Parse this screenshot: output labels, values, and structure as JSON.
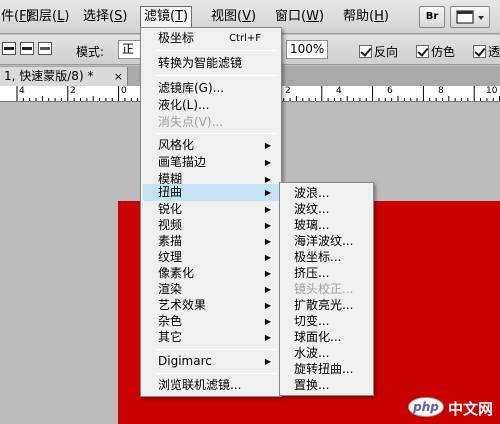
{
  "menubar": {
    "items": [
      {
        "label": "件(",
        "accel": "F",
        "tail": ")"
      },
      {
        "label": "图层(",
        "accel": "L",
        "tail": ")"
      },
      {
        "label": "选择(",
        "accel": "S",
        "tail": ")"
      },
      {
        "label": "滤镜(",
        "accel": "T",
        "tail": ")"
      },
      {
        "label": "视图(",
        "accel": "V",
        "tail": ")"
      },
      {
        "label": "窗口(",
        "accel": "W",
        "tail": ")"
      },
      {
        "label": "帮助(",
        "accel": "H",
        "tail": ")"
      }
    ],
    "bridge_button": "Br"
  },
  "options": {
    "mode_label": "模式:",
    "mode_value": "正常",
    "opacity_value": "100%",
    "reverse_label": "反向",
    "dither_label": "仿色",
    "transparency_label": "透"
  },
  "document": {
    "tab_title": "1, 快速蒙版/8) *",
    "close_glyph": "×"
  },
  "ruler": {
    "labels": [
      "4",
      "2",
      "0",
      "2",
      "4",
      "6",
      "8",
      "10"
    ]
  },
  "filter_menu": {
    "items": [
      {
        "label": "极坐标",
        "shortcut": "Ctrl+F"
      },
      {
        "label": "转换为智能滤镜"
      },
      {
        "label": "滤镜库(G)..."
      },
      {
        "label": "液化(L)..."
      },
      {
        "label": "消失点(V)...",
        "disabled": true
      },
      {
        "label": "风格化"
      },
      {
        "label": "画笔描边"
      },
      {
        "label": "模糊"
      },
      {
        "label": "扭曲"
      },
      {
        "label": "锐化"
      },
      {
        "label": "视频"
      },
      {
        "label": "素描"
      },
      {
        "label": "纹理"
      },
      {
        "label": "像素化"
      },
      {
        "label": "渲染"
      },
      {
        "label": "艺术效果"
      },
      {
        "label": "杂色"
      },
      {
        "label": "其它"
      },
      {
        "label": "Digimarc"
      },
      {
        "label": "浏览联机滤镜..."
      }
    ],
    "arrow_glyph": "▶"
  },
  "distort_submenu": {
    "items": [
      {
        "label": "波浪..."
      },
      {
        "label": "波纹..."
      },
      {
        "label": "玻璃..."
      },
      {
        "label": "海洋波纹..."
      },
      {
        "label": "极坐标..."
      },
      {
        "label": "挤压..."
      },
      {
        "label": "镜头校正...",
        "disabled": true
      },
      {
        "label": "扩散亮光..."
      },
      {
        "label": "切变..."
      },
      {
        "label": "球面化..."
      },
      {
        "label": "水波..."
      },
      {
        "label": "旋转扭曲..."
      },
      {
        "label": "置换..."
      }
    ]
  },
  "watermark": {
    "logo": "php",
    "text": "中文网"
  }
}
